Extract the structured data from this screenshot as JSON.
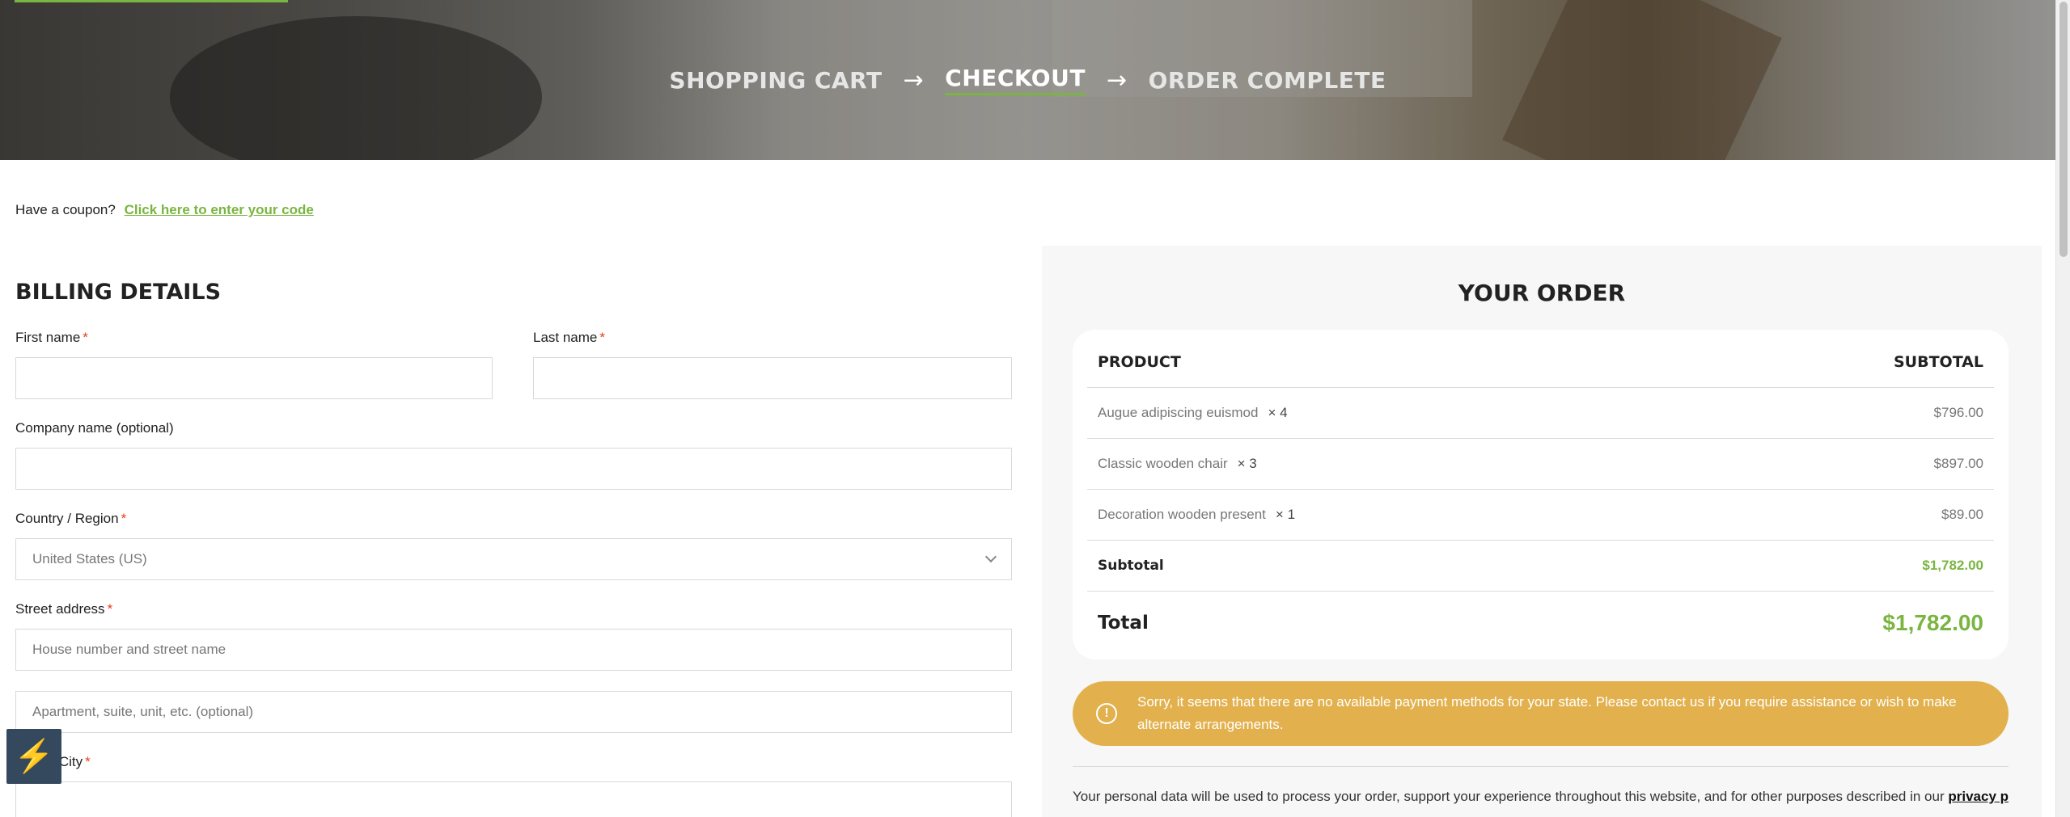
{
  "breadcrumb": {
    "steps": [
      "SHOPPING CART",
      "CHECKOUT",
      "ORDER COMPLETE"
    ],
    "arrow": "→"
  },
  "coupon": {
    "prompt": "Have a coupon?",
    "link": "Click here to enter your code"
  },
  "billing": {
    "title": "BILLING DETAILS",
    "required_mark": "*",
    "first_name_label": "First name",
    "last_name_label": "Last name",
    "company_label": "Company name (optional)",
    "country_label": "Country / Region",
    "country_value": "United States (US)",
    "street_label": "Street address",
    "street_placeholder": "House number and street name",
    "apartment_placeholder": "Apartment, suite, unit, etc. (optional)",
    "city_label": "Town / City"
  },
  "order": {
    "title": "YOUR ORDER",
    "col_product": "PRODUCT",
    "col_subtotal": "SUBTOTAL",
    "items": [
      {
        "name": "Augue adipiscing euismod",
        "qty": "× 4",
        "price": "$796.00"
      },
      {
        "name": "Classic wooden chair",
        "qty": "× 3",
        "price": "$897.00"
      },
      {
        "name": "Decoration wooden present",
        "qty": "× 1",
        "price": "$89.00"
      }
    ],
    "subtotal_label": "Subtotal",
    "subtotal_value": "$1,782.00",
    "total_label": "Total",
    "total_value": "$1,782.00",
    "notice": "Sorry, it seems that there are no available payment methods for your state. Please contact us if you require assistance or wish to make alternate arrangements.",
    "notice_icon": "!",
    "privacy_text": "Your personal data will be used to process your order, support your experience throughout this website, and for other purposes described in our ",
    "privacy_link": "privacy policy"
  },
  "widget": {
    "icon": "lightning-bolt-icon",
    "glyph": "⚡"
  },
  "colors": {
    "accent": "#7ab541",
    "notice": "#e2b14e",
    "required": "#e2401c"
  }
}
